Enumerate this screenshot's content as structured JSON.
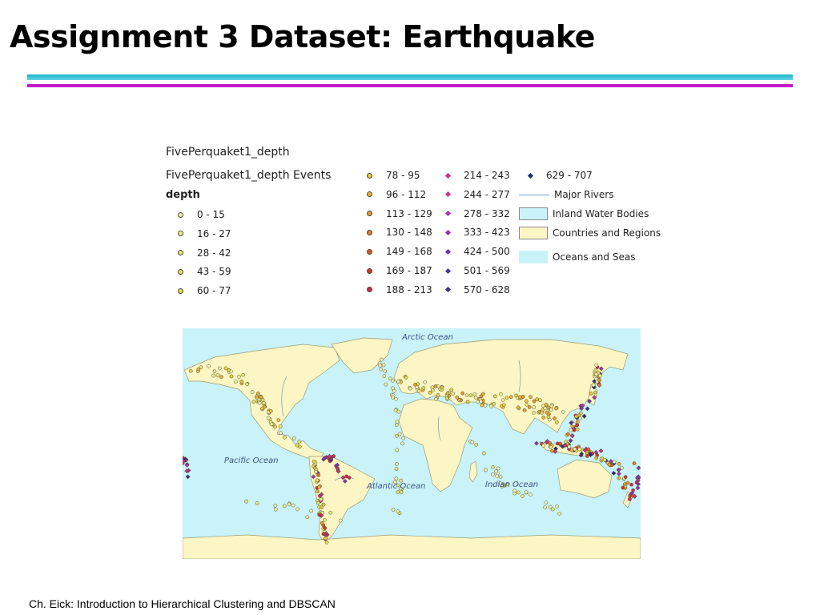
{
  "slide": {
    "title": "Assignment 3 Dataset: Earthquake",
    "footer": "Ch. Eick: Introduction to Hierarchical Clustering and DBSCAN"
  },
  "legend": {
    "layer_name": "FivePerquaket1_depth",
    "events_label": "FivePerquaket1_depth Events",
    "field_label": "depth",
    "depth_classes": [
      {
        "label": "0 - 15",
        "color": "#f2f2b8"
      },
      {
        "label": "16 - 27",
        "color": "#f0f09a"
      },
      {
        "label": "28 - 42",
        "color": "#e8e87c"
      },
      {
        "label": "43 - 59",
        "color": "#e6e060"
      },
      {
        "label": "60 - 77",
        "color": "#e6d850"
      },
      {
        "label": "78 - 95",
        "color": "#e8c840"
      },
      {
        "label": "96 - 112",
        "color": "#e8b238"
      },
      {
        "label": "113 - 129",
        "color": "#e89830"
      },
      {
        "label": "130 - 148",
        "color": "#e47a2a"
      },
      {
        "label": "149 - 168",
        "color": "#e05828"
      },
      {
        "label": "169 - 187",
        "color": "#d83030"
      },
      {
        "label": "188 - 213",
        "color": "#d42858"
      },
      {
        "label": "214 - 243",
        "color": "#d02c80"
      },
      {
        "label": "244 - 277",
        "color": "#c830a0"
      },
      {
        "label": "278 - 332",
        "color": "#b030b8"
      },
      {
        "label": "333 - 423",
        "color": "#9030c0"
      },
      {
        "label": "424 - 500",
        "color": "#7030b8"
      },
      {
        "label": "501 - 569",
        "color": "#5030a8"
      },
      {
        "label": "570 - 628",
        "color": "#383098"
      },
      {
        "label": "629 - 707",
        "color": "#202878"
      }
    ],
    "reference_layers": [
      {
        "label": "Major Rivers",
        "symbol": "line",
        "color": "#7f9fd0"
      },
      {
        "label": "Inland Water Bodies",
        "symbol": "fill",
        "color": "#c9f3f8"
      },
      {
        "label": "Countries and Regions",
        "symbol": "fill",
        "color": "#fbf6c3"
      },
      {
        "label": "Oceans and Seas",
        "symbol": "fill-noborder",
        "color": "#c9f3f8"
      }
    ]
  },
  "map": {
    "ocean_labels": {
      "arctic": "Arctic Ocean",
      "pacific": "Pacific Ocean",
      "atlantic": "Atlantic Ocean",
      "indian": "Indian Ocean"
    },
    "colors": {
      "ocean": "#c9f3f8",
      "land": "#fbf6c3",
      "border": "#9a9a7a",
      "river": "#7f9fd0"
    }
  }
}
